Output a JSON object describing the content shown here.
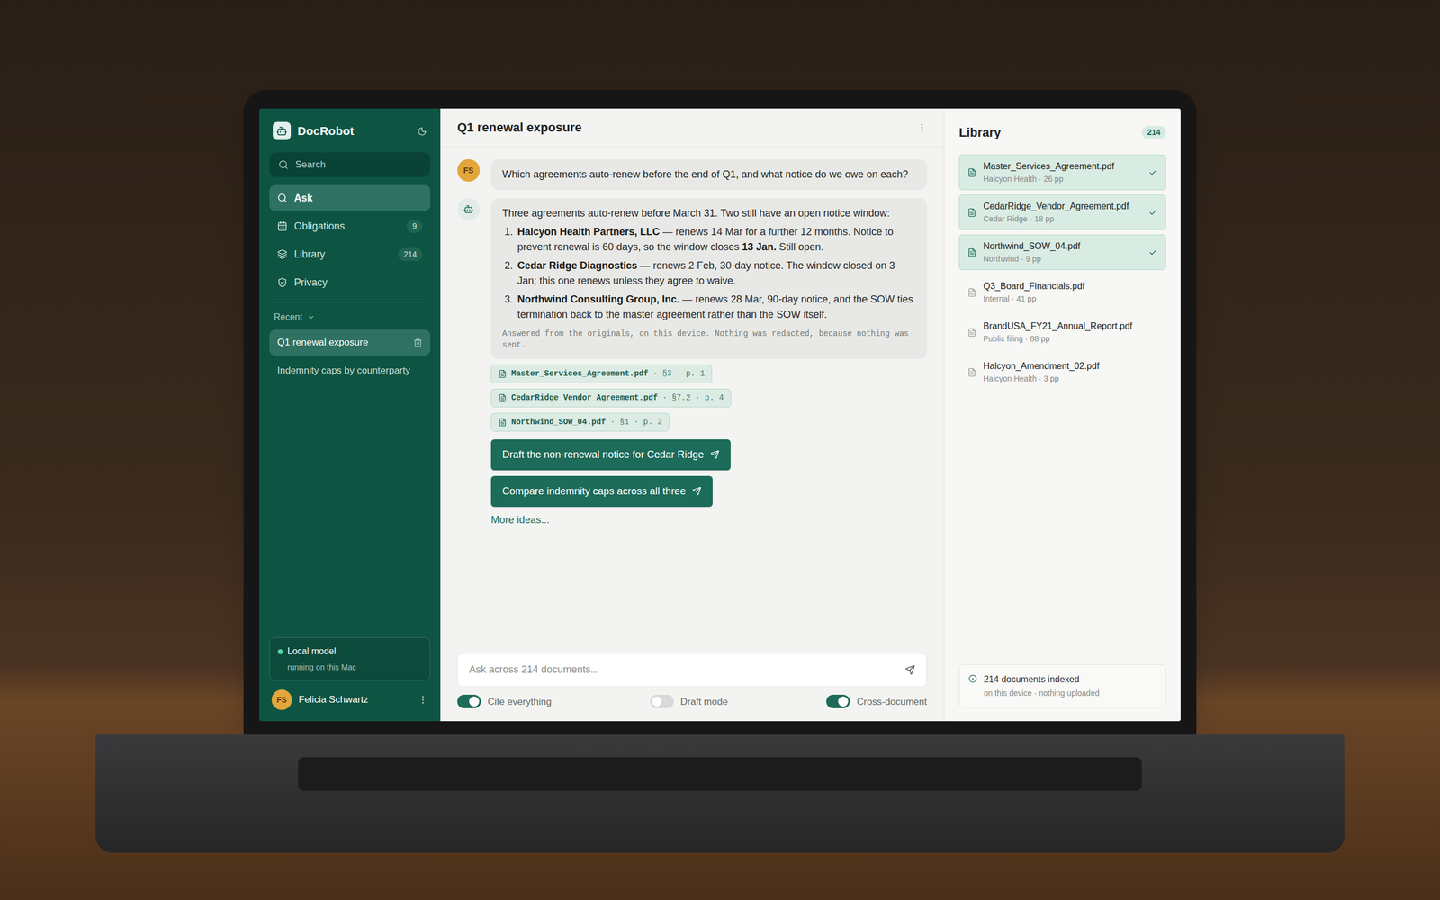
{
  "app": {
    "name": "DocRobot",
    "theme_toggle": "dark"
  },
  "sidebar": {
    "search_placeholder": "Search",
    "items": [
      {
        "label": "Ask",
        "count": "",
        "selected": true,
        "kind": "ask"
      },
      {
        "label": "Obligations",
        "count": "9",
        "selected": false,
        "kind": "obligations"
      },
      {
        "label": "Library",
        "count": "214",
        "selected": false,
        "kind": "library"
      },
      {
        "label": "Privacy",
        "count": "",
        "selected": false,
        "kind": "privacy"
      }
    ],
    "recent": {
      "label": "Recent",
      "expanded": true,
      "items": [
        {
          "label": "Q1 renewal exposure",
          "selected": true
        },
        {
          "label": "Indemnity caps by counterparty",
          "selected": false
        }
      ]
    },
    "model_status": {
      "title": "Local model",
      "subtitle": "running on this Mac",
      "on": true
    },
    "user": {
      "initials": "FS",
      "name": "Felicia Schwartz"
    }
  },
  "chat": {
    "title": "Q1 renewal exposure",
    "question": {
      "initials": "FS",
      "text": "Which agreements auto-renew before the end of Q1, and what notice do we owe on each?"
    },
    "answer": {
      "intro": "Three agreements auto-renew before March 31. Two still have an open notice window:",
      "items": [
        {
          "number": "1.",
          "segments": [
            {
              "text": "Halcyon Health Partners, LLC",
              "bold": true
            },
            {
              "text": " — renews 14 Mar for a further 12 months. Notice to prevent renewal is 60 days, so the window closes ",
              "bold": false
            },
            {
              "text": "13 Jan.",
              "bold": true
            },
            {
              "text": " Still open.",
              "bold": false
            }
          ]
        },
        {
          "number": "2.",
          "segments": [
            {
              "text": "Cedar Ridge Diagnostics",
              "bold": true
            },
            {
              "text": " — renews 2 Feb, 30-day notice. The window closed on 3 Jan; this one renews unless they agree to waive.",
              "bold": false
            }
          ]
        },
        {
          "number": "3.",
          "segments": [
            {
              "text": "Northwind Consulting Group, Inc.",
              "bold": true
            },
            {
              "text": " — renews 28 Mar, 90-day notice, and the SOW ties termination back to the master agreement rather than the SOW itself.",
              "bold": false
            }
          ]
        }
      ],
      "footnote": "Answered from the originals, on this device. Nothing was redacted, because nothing was sent."
    },
    "citations": [
      {
        "file": "Master_Services_Agreement.pdf",
        "ref": "· §3 · p. 1"
      },
      {
        "file": "CedarRidge_Vendor_Agreement.pdf",
        "ref": "· §7.2 · p. 4"
      },
      {
        "file": "Northwind_SOW_04.pdf",
        "ref": "· §1 · p. 2"
      }
    ],
    "actions": [
      "Draft the non-renewal notice for Cedar Ridge",
      "Compare indemnity caps across all three"
    ],
    "more": "More ideas...",
    "input_placeholder": "Ask across 214 documents...",
    "toggles": [
      {
        "label": "Cite everything",
        "on": true
      },
      {
        "label": "Draft mode",
        "on": false
      },
      {
        "label": "Cross-document",
        "on": true
      }
    ]
  },
  "library": {
    "title": "Library",
    "count": "214",
    "files": [
      {
        "name": "Master_Services_Agreement.pdf",
        "meta": "Halcyon Health · 26 pp",
        "selected": true
      },
      {
        "name": "CedarRidge_Vendor_Agreement.pdf",
        "meta": "Cedar Ridge · 18 pp",
        "selected": true
      },
      {
        "name": "Northwind_SOW_04.pdf",
        "meta": "Northwind · 9 pp",
        "selected": true
      },
      {
        "name": "Q3_Board_Financials.pdf",
        "meta": "Internal · 41 pp",
        "selected": false
      },
      {
        "name": "BrandUSA_FY21_Annual_Report.pdf",
        "meta": "Public filing · 88 pp",
        "selected": false
      },
      {
        "name": "Halcyon_Amendment_02.pdf",
        "meta": "Halcyon Health · 3 pp",
        "selected": false
      }
    ],
    "status": {
      "title": "214 documents indexed",
      "subtitle": "on this device · nothing uploaded"
    }
  }
}
